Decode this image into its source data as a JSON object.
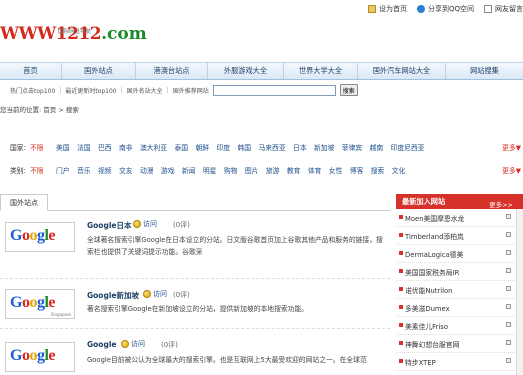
{
  "header": {
    "logo_main": "WWW1212",
    "logo_suffix": ".com",
    "logo_subtitle": "国际网址导航",
    "top_links": [
      {
        "label": "设为首页",
        "icon": "home-icon"
      },
      {
        "label": "分享到QQ空间",
        "icon": "qq-icon"
      },
      {
        "label": "网友留言",
        "icon": "message-icon"
      }
    ]
  },
  "nav": {
    "items": [
      "首页",
      "国外站点",
      "港澳台站点",
      "外服游戏大全",
      "世界大学大全",
      "国外汽车网站大全",
      "网站搜集"
    ]
  },
  "subbar": {
    "links": [
      "热门点击top100",
      "最近更新时top100",
      "国外名站大全",
      "国外推荐网站"
    ],
    "search_value": "",
    "search_button": "搜索"
  },
  "breadcrumb": "您当前的位置: 首页 > 搜索",
  "filters": {
    "country": {
      "label": "国家:",
      "nolimit": "不限",
      "options": [
        "美国",
        "法国",
        "巴西",
        "南非",
        "澳大利亚",
        "泰国",
        "朝鲜",
        "印度",
        "韩国",
        "马来西亚",
        "日本",
        "新加坡",
        "菲律宾",
        "越南",
        "印度尼西亚"
      ],
      "more": "更多▼"
    },
    "category": {
      "label": "类别:",
      "nolimit": "不限",
      "options": [
        "门户",
        "音乐",
        "视频",
        "交友",
        "动漫",
        "游戏",
        "新闻",
        "明星",
        "购物",
        "图片",
        "旅游",
        "教育",
        "体育",
        "女性",
        "博客",
        "搜索",
        "文化"
      ],
      "more": "更多▼"
    }
  },
  "content": {
    "tab": "国外站点",
    "entries": [
      {
        "title": "Google日本",
        "visit": "访问",
        "reviews": "(0评)",
        "logo_text": [
          "G",
          "o",
          "o",
          "g",
          "l",
          "e"
        ],
        "logo_tag": "",
        "description": "全球著名搜索引擎Google在日本设立的分站。日文版谷歌首页加上谷歌其他产品和服务的链接，搜索栏也提供了关键词提示功能。谷歌采"
      },
      {
        "title": "Google新加坡",
        "visit": "访问",
        "reviews": "(0评)",
        "logo_text": [
          "G",
          "o",
          "o",
          "g",
          "l",
          "e"
        ],
        "logo_tag": "Singapore",
        "description": "著名搜索引擎Google在新加坡设立的分站，提供新加坡的本地搜索功能。"
      },
      {
        "title": "Google",
        "visit": "访问",
        "reviews": "(0评)",
        "logo_text": [
          "G",
          "o",
          "o",
          "g",
          "l",
          "e"
        ],
        "logo_tag": "",
        "description": "Google目前被公认为全球最大的搜索引擎。也是互联网上5大最受欢迎的网站之一。在全球范"
      }
    ]
  },
  "sidebar": {
    "title": "最新加入网站",
    "more": "更多>>",
    "items": [
      "Moen美国摩恩水龙",
      "Timberland添柏岚",
      "DermaLogica德美",
      "美国国家税务局IR",
      "诺优能Nutrilon",
      "多美滋Dumex",
      "美素佳儿Friso",
      "神舞幻想台服官网",
      "特步XTEP"
    ]
  },
  "colors": {
    "brand_red": "#d7281b",
    "brand_green": "#1a8a2b",
    "nav_blue": "#1d3f66",
    "sidebar_red": "#d6322a"
  }
}
